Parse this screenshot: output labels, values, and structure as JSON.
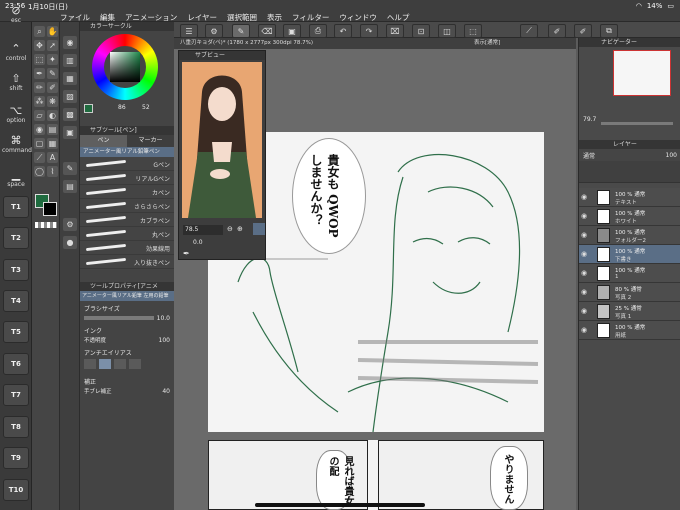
{
  "status": {
    "time": "23:56",
    "date": "1月10日(日)",
    "battery": "14%"
  },
  "menu": [
    "ファイル",
    "編集",
    "アニメーション",
    "レイヤー",
    "選択範囲",
    "表示",
    "フィルター",
    "ウィンドウ",
    "ヘルプ"
  ],
  "edge": {
    "esc": "esc",
    "control": "control",
    "shift": "shift",
    "option": "option",
    "command": "command",
    "space": "space",
    "buttons": [
      "T1",
      "T2",
      "T3",
      "T4",
      "T5",
      "T6",
      "T7",
      "T8",
      "T9",
      "T10"
    ]
  },
  "color_panel": {
    "title": "カラーサークル",
    "values": [
      "86",
      "52"
    ]
  },
  "subtool_panel": {
    "title": "サブツール[ペン]",
    "tabs": [
      "ペン",
      "マーカー"
    ],
    "set_name": "アニメーター風リアル鉛筆ペン",
    "brushes": [
      "Gペン",
      "リアルGペン",
      "カペン",
      "さらさらペン",
      "カブラペン",
      "丸ペン",
      "効果線用",
      "入り抜きペン"
    ]
  },
  "tool_property": {
    "title": "ツールプロパティ[アニメ",
    "subtitle": "アニメーター風リアル鉛筆 左用の鉛筆",
    "brush_size_label": "ブラシサイズ",
    "brush_size": "10.0",
    "ink_label": "インク",
    "opacity_label": "不透明度",
    "opacity": "100",
    "antialias_label": "アンチエイリアス",
    "correction_label": "補正",
    "stabilize_label": "手ブレ補正",
    "stabilize": "40"
  },
  "document": {
    "tab_title": "八重刃キョダ(ペ)* (1780 x 2777px 300dpi 78.7%)",
    "tab2": "表示[通常]"
  },
  "subview": {
    "title": "サブビュー",
    "zoom": "78.5",
    "angle": "0.0"
  },
  "navigator": {
    "title": "ナビゲーター",
    "zoom": "79.7"
  },
  "layers": {
    "title": "レイヤー",
    "blend": "通常",
    "opacity": "100",
    "items": [
      {
        "pct": "100 % 通常",
        "name": "テキスト"
      },
      {
        "pct": "100 % 通常",
        "name": "ホワイト"
      },
      {
        "pct": "100 % 通常",
        "name": "フォルダー2"
      },
      {
        "pct": "100 % 通常",
        "name": "下書き"
      },
      {
        "pct": "100 % 通常",
        "name": "1"
      },
      {
        "pct": "80 % 通常",
        "name": "写真 2"
      },
      {
        "pct": "25 % 通常",
        "name": "写真 1"
      },
      {
        "pct": "100 % 通常",
        "name": "用紙"
      }
    ]
  },
  "manga": {
    "bubble_main": "貴女も QWOP しませんか？",
    "bubble_bottom_left": "見れば貴女の配",
    "bubble_bottom_right": "やりません"
  },
  "colors": {
    "accent_selected": "#5a6e86",
    "color_main": "#1f6b3f",
    "line_art": "#2f6f4a"
  }
}
